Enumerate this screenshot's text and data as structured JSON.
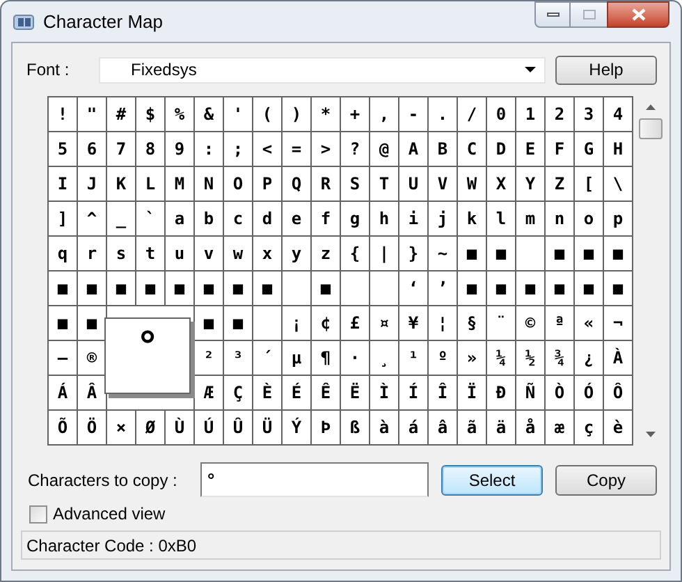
{
  "window": {
    "title": "Character Map"
  },
  "font": {
    "label": "Font :",
    "value": "Fixedsys"
  },
  "help_button": "Help",
  "grid": [
    [
      "!",
      "\"",
      "#",
      "$",
      "%",
      "&",
      "'",
      "(",
      ")",
      "*",
      "+",
      ",",
      "-",
      ".",
      "/",
      "0",
      "1",
      "2",
      "3",
      "4"
    ],
    [
      "5",
      "6",
      "7",
      "8",
      "9",
      ":",
      ";",
      "<",
      "=",
      ">",
      "?",
      "@",
      "A",
      "B",
      "C",
      "D",
      "E",
      "F",
      "G",
      "H"
    ],
    [
      "I",
      "J",
      "K",
      "L",
      "M",
      "N",
      "O",
      "P",
      "Q",
      "R",
      "S",
      "T",
      "U",
      "V",
      "W",
      "X",
      "Y",
      "Z",
      "[",
      "\\"
    ],
    [
      "]",
      "^",
      "_",
      "`",
      "a",
      "b",
      "c",
      "d",
      "e",
      "f",
      "g",
      "h",
      "i",
      "j",
      "k",
      "l",
      "m",
      "n",
      "o",
      "p"
    ],
    [
      "q",
      "r",
      "s",
      "t",
      "u",
      "v",
      "w",
      "x",
      "y",
      "z",
      "{",
      "|",
      "}",
      "~",
      "■",
      "■",
      {
        "kind": "blank"
      },
      "■",
      "■",
      "■"
    ],
    [
      "■",
      "■",
      "■",
      "■",
      "■",
      "■",
      "■",
      "■",
      {
        "kind": "blank"
      },
      "■",
      {
        "kind": "blank"
      },
      {
        "kind": "blank"
      },
      "‘",
      "’",
      "■",
      "■",
      "■",
      "■",
      "■",
      "■"
    ],
    [
      "■",
      "■",
      "■",
      "■",
      {
        "kind": "blank"
      },
      "¡",
      "¢",
      "£",
      "¤",
      "¥",
      "¦",
      "§",
      "¨",
      "©",
      "ª",
      "«",
      "¬"
    ],
    [
      "–",
      "®",
      "²",
      "³",
      "´",
      "µ",
      "¶",
      "·",
      "¸",
      "¹",
      "º",
      "»",
      "¼",
      "½",
      "¾",
      "¿",
      "À"
    ],
    [
      "Á",
      "Â",
      "Æ",
      "Ç",
      "È",
      "É",
      "Ê",
      "Ë",
      "Ì",
      "Í",
      "Î",
      "Ï",
      "Ð",
      "Ñ",
      "Ò",
      "Ó",
      "Ô"
    ],
    [
      "Õ",
      "Ö",
      "×",
      "Ø",
      "Ù",
      "Ú",
      "Û",
      "Ü",
      "Ý",
      "Þ",
      "ß",
      "à",
      "á",
      "â",
      "ã",
      "ä",
      "å",
      "æ",
      "ç",
      "è"
    ]
  ],
  "popup": {
    "char": "°"
  },
  "copy": {
    "label": "Characters to copy :",
    "value": "°"
  },
  "buttons": [
    {
      "label": "Select",
      "focused": true
    },
    {
      "label": "Copy",
      "focused": false
    }
  ],
  "advanced_view": {
    "label": "Advanced view",
    "checked": false
  },
  "status_bar": "Character Code : 0xB0"
}
